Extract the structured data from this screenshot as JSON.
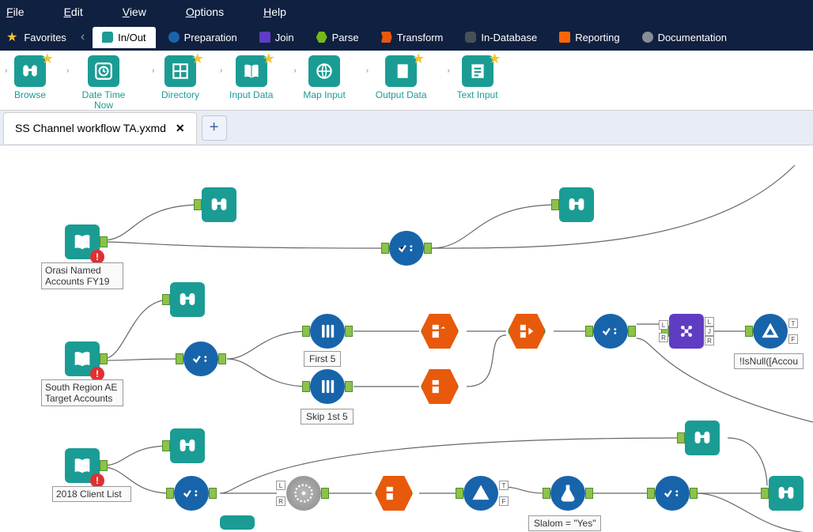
{
  "menu": {
    "file": "File",
    "edit": "Edit",
    "view": "View",
    "options": "Options",
    "help": "Help"
  },
  "ribbon": {
    "favorites": "Favorites",
    "categories": [
      {
        "label": "In/Out",
        "color": "#1a9c94",
        "active": true
      },
      {
        "label": "Preparation",
        "color": "#1864ab"
      },
      {
        "label": "Join",
        "color": "#5f3dc3"
      },
      {
        "label": "Parse",
        "color": "#74b816"
      },
      {
        "label": "Transform",
        "color": "#e8590c"
      },
      {
        "label": "In-Database",
        "color": "#495057"
      },
      {
        "label": "Reporting",
        "color": "#f76707"
      },
      {
        "label": "Documentation",
        "color": "#868e96"
      }
    ]
  },
  "palette": {
    "tools": [
      {
        "label": "Browse"
      },
      {
        "label": "Date Time Now"
      },
      {
        "label": "Directory"
      },
      {
        "label": "Input Data"
      },
      {
        "label": "Map Input"
      },
      {
        "label": "Output Data"
      },
      {
        "label": "Text Input"
      }
    ]
  },
  "tab": {
    "name": "SS Channel workflow TA.yxmd"
  },
  "canvas": {
    "labels": {
      "orasi": "Orasi Named Accounts FY19",
      "south": "South Region AE Target Accounts",
      "clients": "2018 Client List",
      "first5": "First 5",
      "skip5": "Skip 1st 5",
      "isnull": "!IsNull([Accou",
      "slalom": "Slalom = \"Yes\""
    }
  }
}
